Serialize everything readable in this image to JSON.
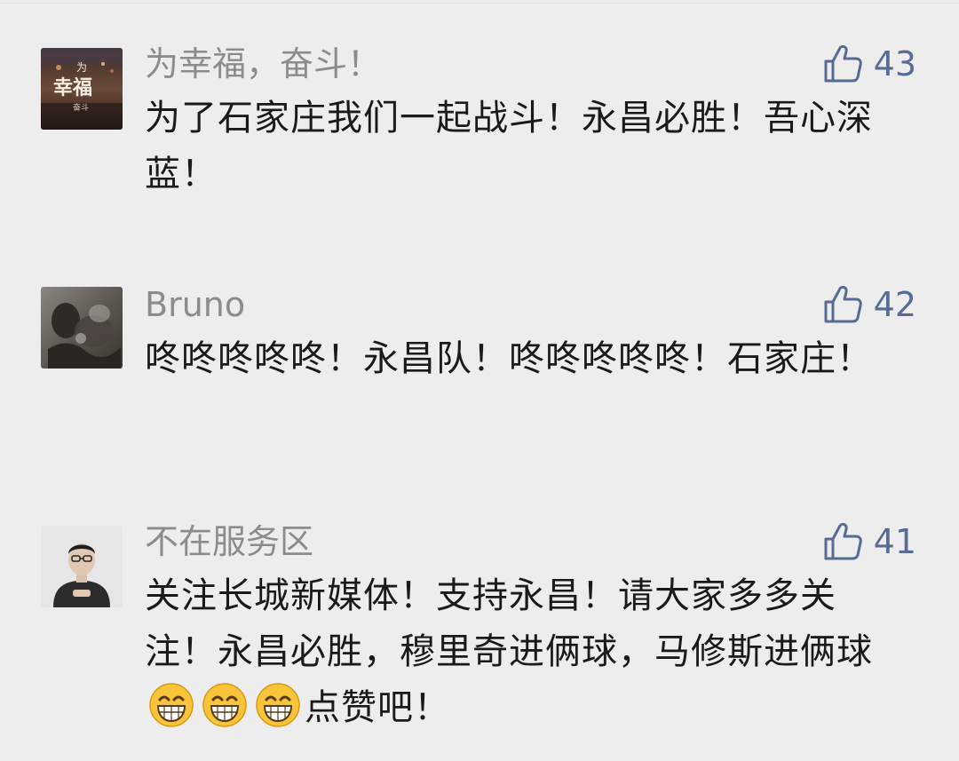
{
  "comments": [
    {
      "user": "为幸福，奋斗！",
      "likes": "43",
      "content": "为了石家庄我们一起战斗！永昌必胜！吾心深蓝！",
      "avatar_lines": [
        "为",
        "幸福",
        "奋斗"
      ],
      "content_suffix": ""
    },
    {
      "user": "Bruno",
      "likes": "42",
      "content": "咚咚咚咚咚！永昌队！咚咚咚咚咚！石家庄！",
      "content_suffix": ""
    },
    {
      "user": "不在服务区",
      "likes": "41",
      "content": "关注长城新媒体！支持永昌！请大家多多关注！永昌必胜，穆里奇进俩球，马修斯进俩球",
      "emojis": [
        "grin-emoji",
        "grin-emoji",
        "grin-emoji"
      ],
      "content_suffix": "点赞吧！"
    }
  ],
  "icons": {
    "like": "thumbs-up-icon",
    "emoji": "grin-emoji"
  },
  "colors": {
    "background": "#ededed",
    "username": "#8c8c8c",
    "like_accent": "#576b95",
    "content_text": "#1a1a1a"
  }
}
